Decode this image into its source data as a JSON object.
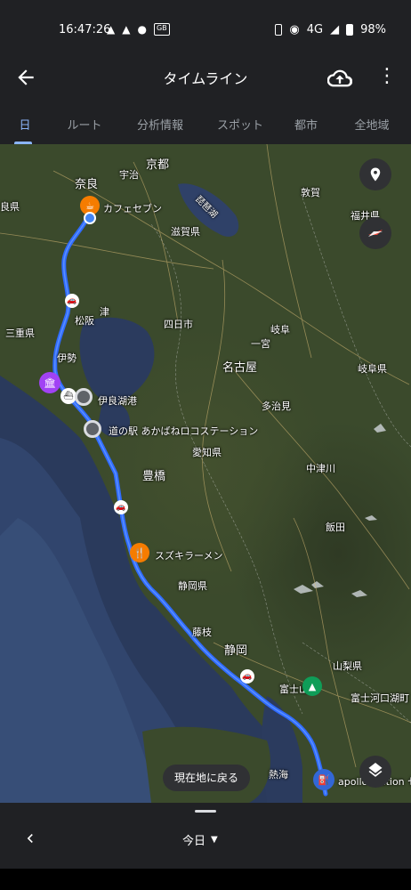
{
  "status_bar": {
    "time": "16:47:26",
    "left_icons": [
      "warning-icon",
      "navigation-icon",
      "location-pin-icon",
      "gb-badge-icon"
    ],
    "gb_badge": "GB",
    "network": "4G",
    "battery": "98%"
  },
  "app_bar": {
    "title": "タイムライン"
  },
  "tabs": [
    "日",
    "ルート",
    "分析情報",
    "スポット",
    "都市",
    "全地域"
  ],
  "active_tab": 0,
  "map": {
    "labels": {
      "kyoto": "京都",
      "nara": "奈良",
      "uji": "宇治",
      "biwako": "琵琶湖",
      "shiga": "滋賀県",
      "tsuruga": "敦賀",
      "fukui": "福井県",
      "mie": "三重県",
      "matsusaka": "松阪",
      "tsu": "津",
      "ise": "伊勢",
      "yokkaichi": "四日市",
      "ichinomiya": "一宮",
      "gifu": "岐阜",
      "gifu_pref": "岐阜県",
      "nagoya": "名古屋",
      "tajimi": "多治見",
      "aichi": "愛知県",
      "irago": "伊良湖港",
      "akabane": "道の駅 あかばねロコステーション",
      "toyohashi": "豊橋",
      "nakatsugawa": "中津川",
      "iida": "飯田",
      "shizuoka_pref": "静岡県",
      "fujieda": "藤枝",
      "shizuoka": "静岡",
      "yamanashi": "山梨県",
      "fujisan": "富士山",
      "fujikawaguchiko": "富士河口湖町",
      "atami": "熱海",
      "kaken": "良県",
      "cafe": "カフェセブン",
      "ramen": "スズキラーメン",
      "apollo": "apollo station セ"
    },
    "return_button": "現在地に戻る"
  },
  "bottom": {
    "date_label": "今日"
  }
}
